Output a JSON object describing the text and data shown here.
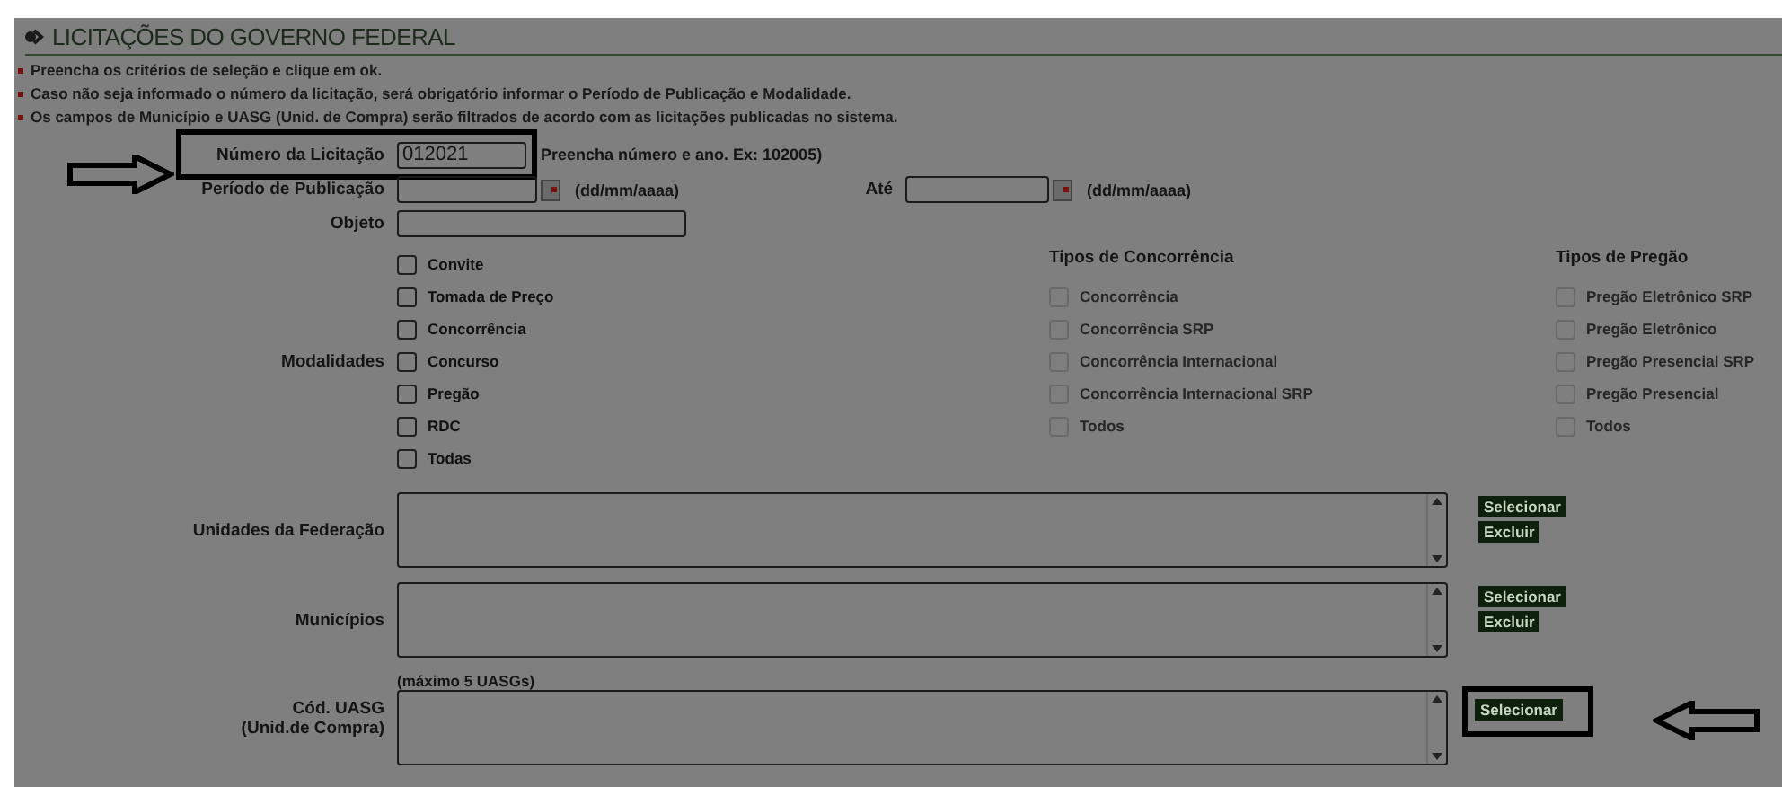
{
  "header": {
    "title": "LICITAÇÕES DO GOVERNO FEDERAL"
  },
  "notes": [
    "Preencha os critérios de seleção e clique em ok.",
    "Caso não seja informado o número da licitação, será obrigatório informar o Período de Publicação e Modalidade.",
    "Os campos de Município e UASG (Unid. de Compra) serão filtrados de acordo com as licitações publicadas no sistema."
  ],
  "numero": {
    "label": "Número da Licitação",
    "value": "012021",
    "hint": "Preencha número e ano. Ex: 102005)"
  },
  "periodo": {
    "label": "Período de Publicação",
    "hint": "(dd/mm/aaaa)",
    "ate_label": "Até",
    "ate_hint": "(dd/mm/aaaa)"
  },
  "objeto": {
    "label": "Objeto"
  },
  "modalidades": {
    "label": "Modalidades",
    "groups": [
      {
        "items": [
          {
            "label": "Convite",
            "checked": false,
            "disabled": false
          },
          {
            "label": "Tomada de Preço",
            "checked": false,
            "disabled": false
          },
          {
            "label": "Concorrência",
            "checked": false,
            "disabled": false
          },
          {
            "label": "Concurso",
            "checked": false,
            "disabled": false
          },
          {
            "label": "Pregão",
            "checked": false,
            "disabled": false
          },
          {
            "label": "RDC",
            "checked": false,
            "disabled": false
          },
          {
            "label": "Todas",
            "checked": false,
            "disabled": false
          }
        ]
      },
      {
        "title": "Tipos de Concorrência",
        "items": [
          {
            "label": "Concorrência",
            "checked": false,
            "disabled": true
          },
          {
            "label": "Concorrência SRP",
            "checked": false,
            "disabled": true
          },
          {
            "label": "Concorrência Internacional",
            "checked": false,
            "disabled": true
          },
          {
            "label": "Concorrência Internacional SRP",
            "checked": false,
            "disabled": true
          },
          {
            "label": "Todos",
            "checked": false,
            "disabled": true
          }
        ]
      },
      {
        "title": "Tipos de Pregão",
        "items": [
          {
            "label": "Pregão Eletrônico SRP",
            "checked": false,
            "disabled": true
          },
          {
            "label": "Pregão Eletrônico",
            "checked": false,
            "disabled": true
          },
          {
            "label": "Pregão Presencial SRP",
            "checked": false,
            "disabled": true
          },
          {
            "label": "Pregão Presencial",
            "checked": false,
            "disabled": true
          },
          {
            "label": "Todos",
            "checked": false,
            "disabled": true
          }
        ]
      }
    ]
  },
  "lists": [
    {
      "label": [
        "Unidades da Federação"
      ],
      "buttons": [
        "Selecionar",
        "Excluir"
      ]
    },
    {
      "label": [
        "Municípios"
      ],
      "buttons": [
        "Selecionar",
        "Excluir"
      ]
    },
    {
      "label": [
        "Cód. UASG",
        "(Unid.de Compra)"
      ],
      "note": "(máximo 5 UASGs)",
      "buttons": [
        "Selecionar"
      ],
      "highlighted": true
    }
  ]
}
